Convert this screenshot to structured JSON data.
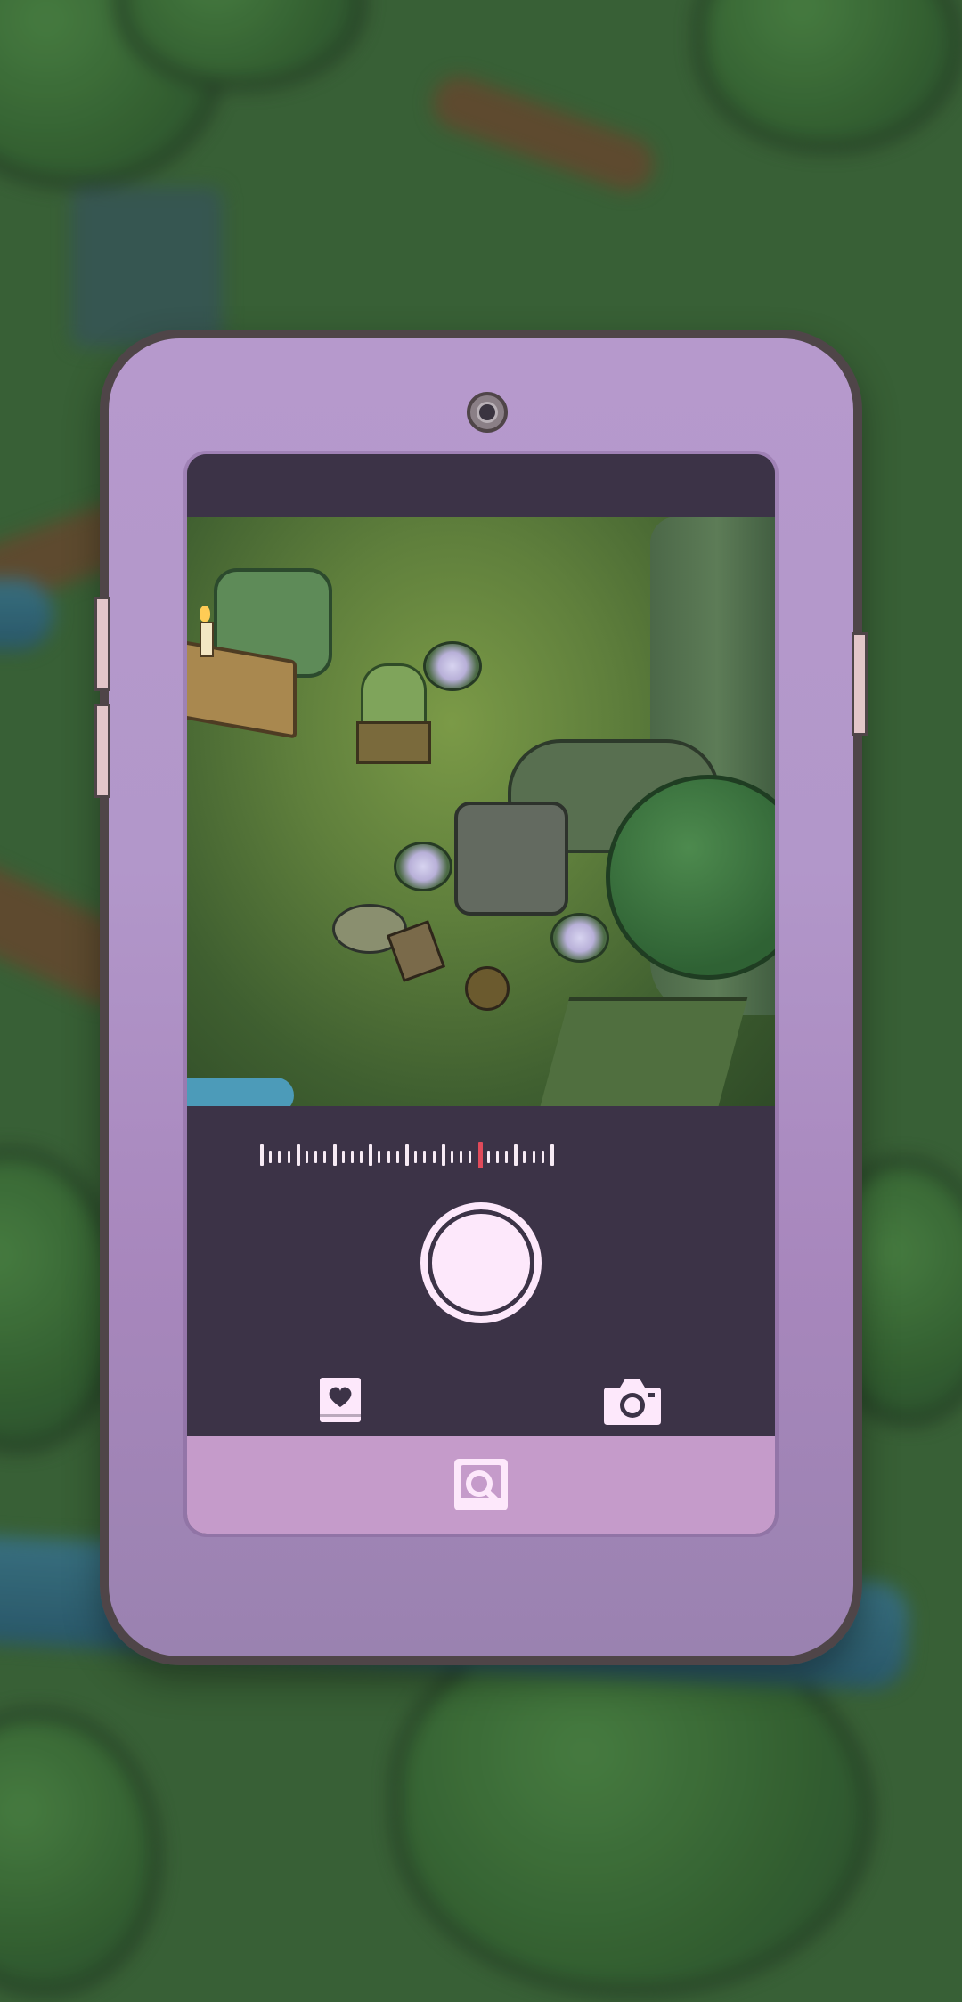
{
  "app": {
    "name": "Phone camera"
  },
  "colors": {
    "phone_body": "#b699cc",
    "phone_outline": "#4f4548",
    "screen_bg": "#3c3347",
    "bottom_bar": "#c59bca",
    "shutter": "#fde8fb",
    "zoom_indicator": "#e04a5a",
    "icon_fill": "#fde8fb"
  },
  "zoom": {
    "tick_count": 33,
    "active_tick_index": 24,
    "major_every": 4
  },
  "controls": {
    "shutter_icon": "shutter-circle",
    "gallery_icon": "photo-heart-icon",
    "camera_icon": "camera-icon",
    "mode_icon": "photo-mode-icon"
  }
}
